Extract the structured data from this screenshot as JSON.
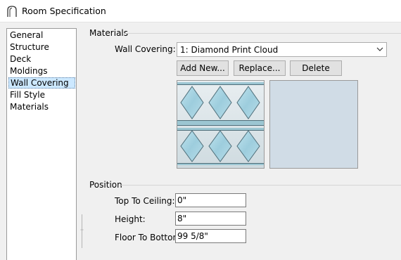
{
  "window": {
    "title": "Room Specification"
  },
  "nav": {
    "items": [
      {
        "label": "General",
        "selected": false
      },
      {
        "label": "Structure",
        "selected": false
      },
      {
        "label": "Deck",
        "selected": false
      },
      {
        "label": "Moldings",
        "selected": false
      },
      {
        "label": "Wall Covering",
        "selected": true
      },
      {
        "label": "Fill Style",
        "selected": false
      },
      {
        "label": "Materials",
        "selected": false
      }
    ]
  },
  "materials": {
    "group_title": "Materials",
    "wall_covering_label": "Wall Covering:",
    "wall_covering_value": "1:  Diamond Print Cloud",
    "add_new_label": "Add New...",
    "replace_label": "Replace...",
    "delete_label": "Delete",
    "preview_color": "#d0dce6",
    "swatch_colors": {
      "band": "#9cc6d2",
      "diamond": "#a7d4e2",
      "edge": "#4f6e79",
      "background": "#dde6ea"
    }
  },
  "position": {
    "group_title": "Position",
    "top_to_ceiling_label": "Top To Ceiling:",
    "top_to_ceiling_value": "0\"",
    "height_label": "Height:",
    "height_value": "8\"",
    "floor_to_bottom_label": "Floor To Bottom:",
    "floor_to_bottom_value": "99 5/8\""
  },
  "icons": {
    "app": "chief-architect-arch-icon",
    "combo": "chevron-down-icon"
  }
}
